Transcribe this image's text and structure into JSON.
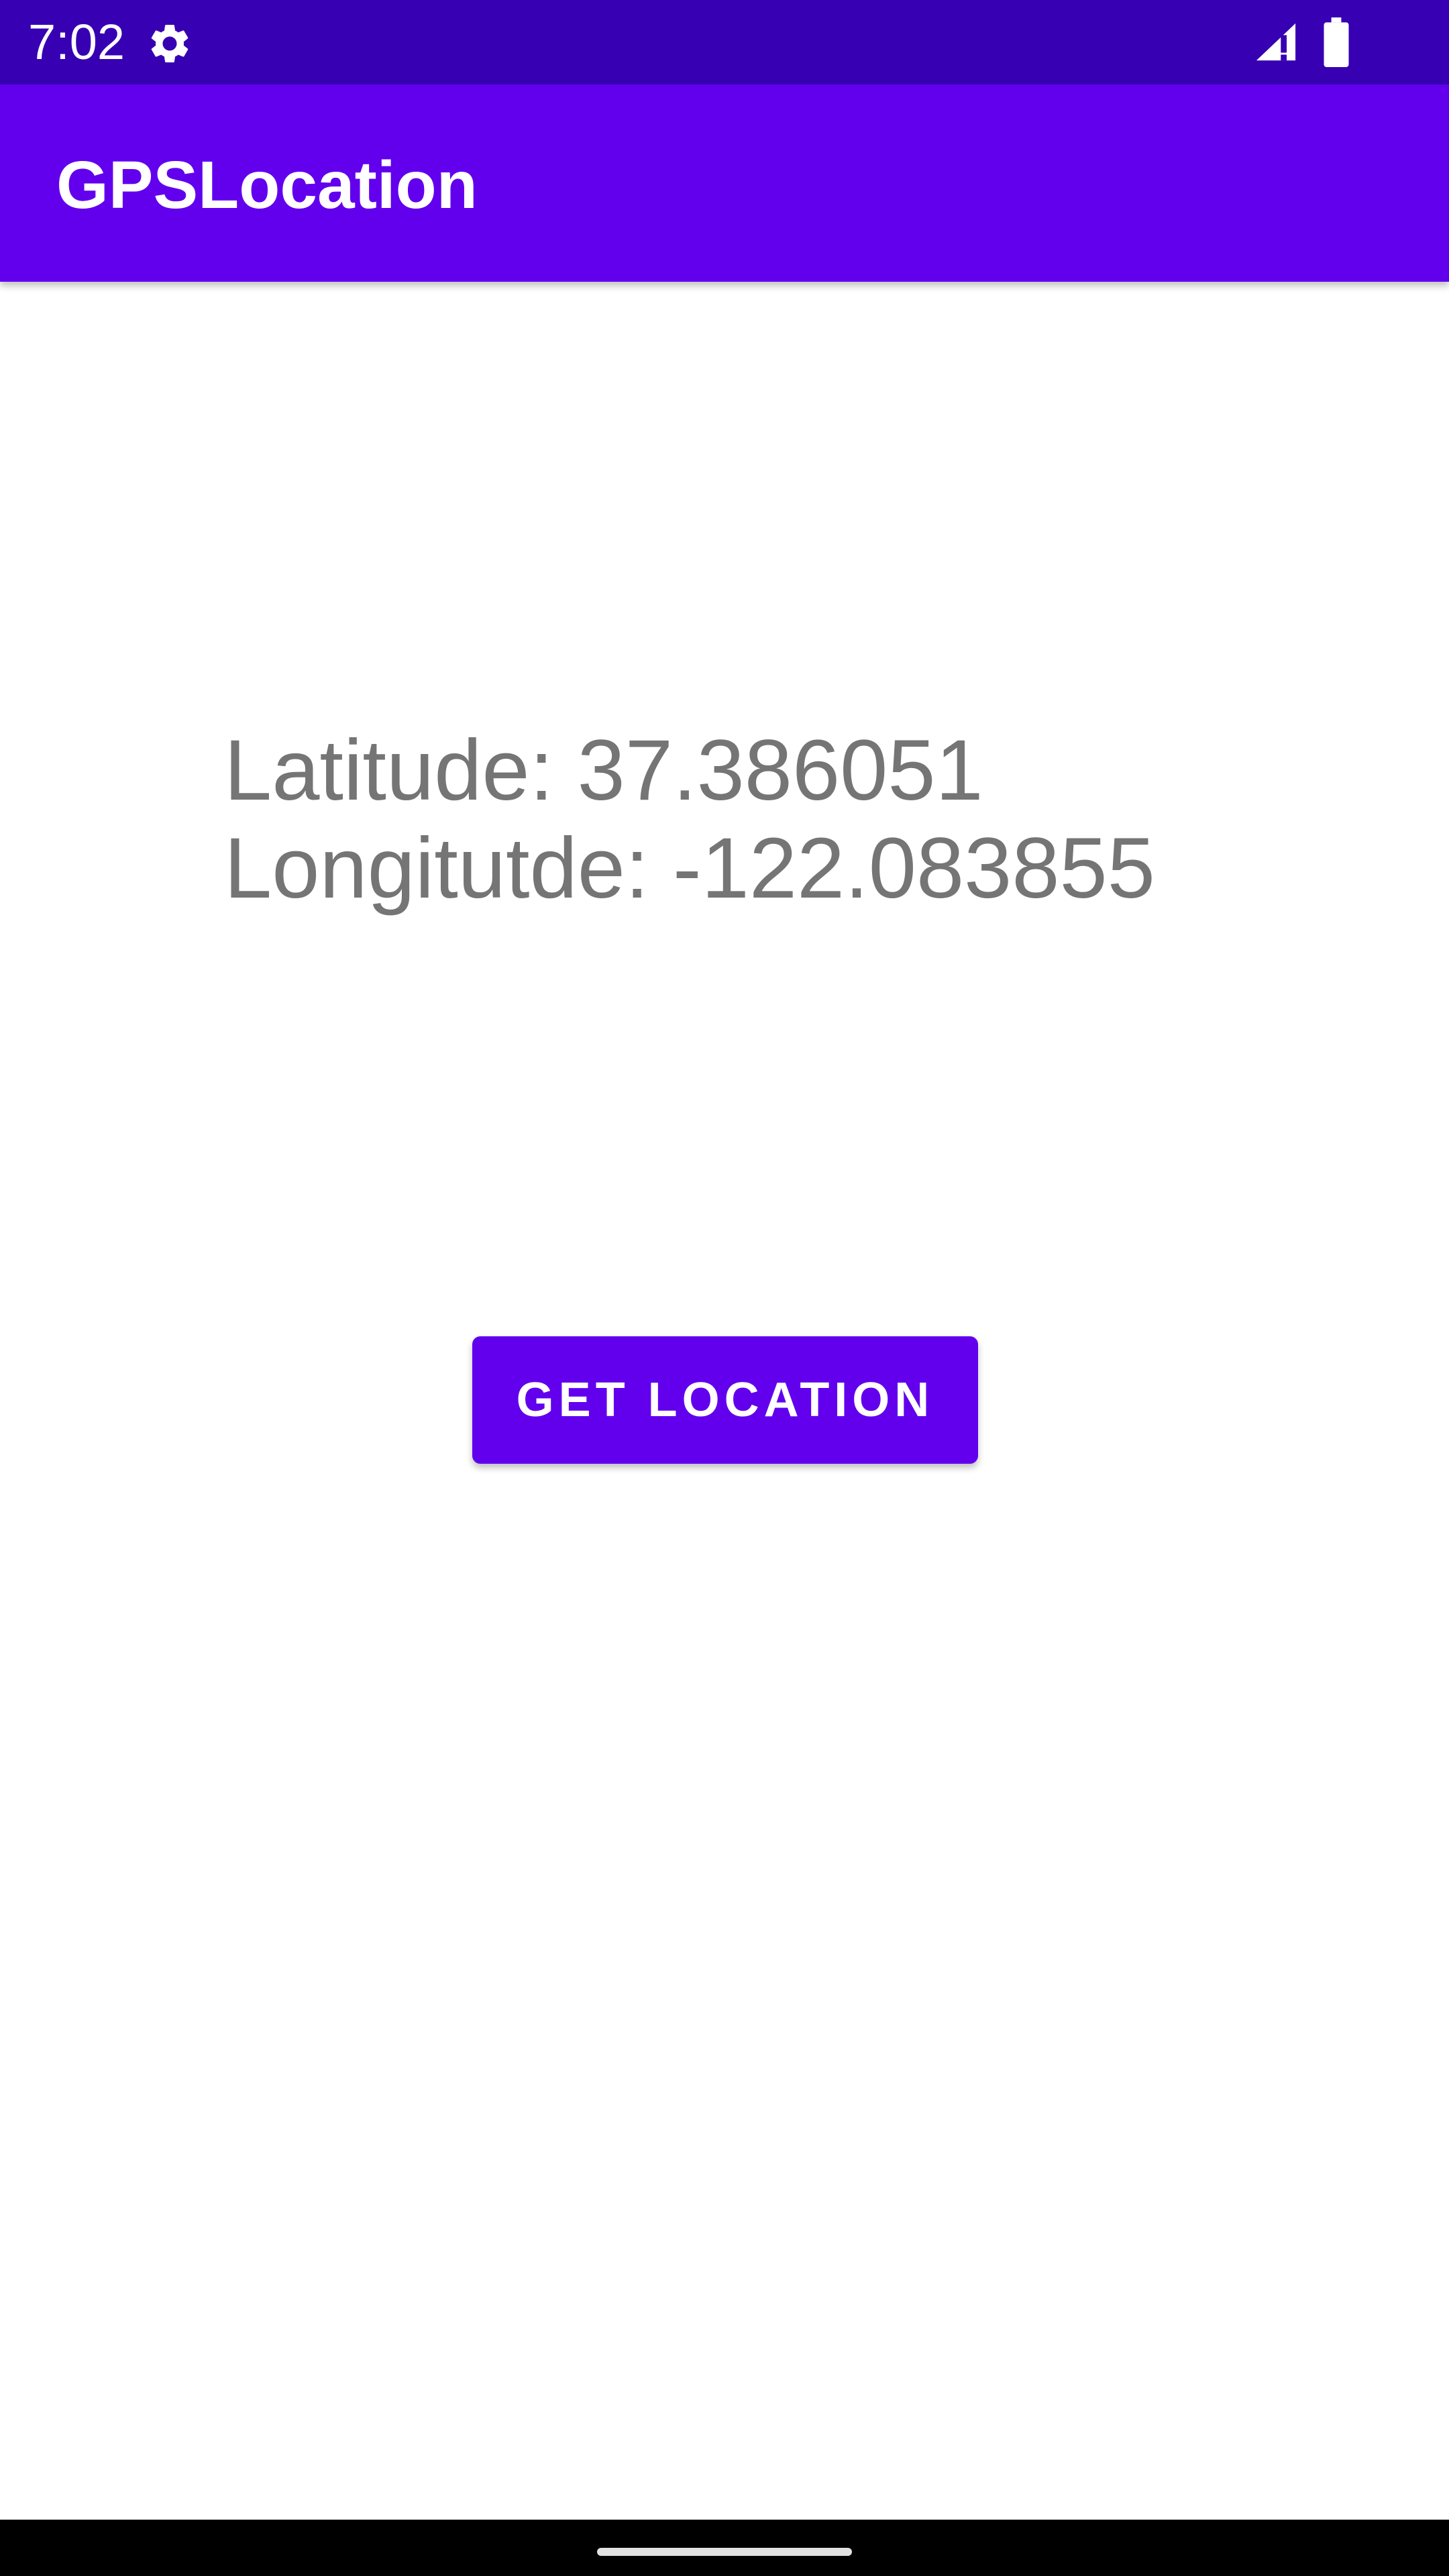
{
  "status_bar": {
    "time": "7:02",
    "icons": [
      "gear-icon",
      "signal-icon",
      "battery-icon"
    ]
  },
  "app_bar": {
    "title": "GPSLocation"
  },
  "location": {
    "latitude_text": "Latitude: 37.386051",
    "longitude_text": "Longitutde: -122.083855"
  },
  "actions": {
    "get_location_label": "GET LOCATION"
  },
  "colors": {
    "status_bar": "#3700B3",
    "primary": "#6200EE",
    "text_secondary": "#757575",
    "background": "#FFFFFF"
  }
}
